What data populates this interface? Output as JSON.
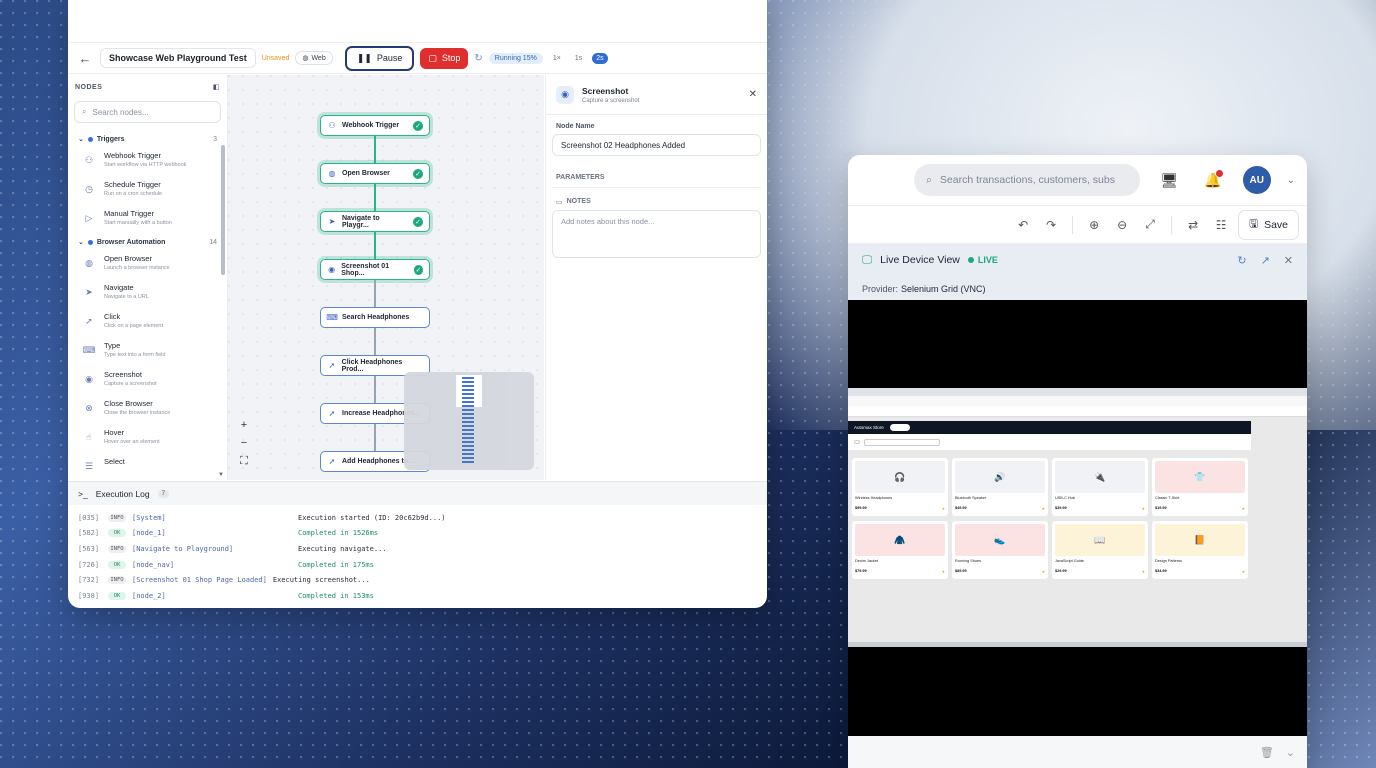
{
  "editor": {
    "workflow_name": "Showcase Web Playground Test",
    "unsaved": "Unsaved",
    "platform": "Web",
    "pause_label": "Pause",
    "stop_label": "Stop",
    "running_label": "Running 15%",
    "running_progress": 0.15,
    "speeds": [
      "1×",
      "1s",
      "2s"
    ],
    "active_speed": "2s"
  },
  "sidebar": {
    "title": "NODES",
    "search_placeholder": "Search nodes...",
    "categories": [
      {
        "name": "Triggers",
        "count": "3",
        "items": [
          {
            "title": "Webhook Trigger",
            "desc": "Start workflow via HTTP webhook",
            "icon": "webhook-icon"
          },
          {
            "title": "Schedule Trigger",
            "desc": "Run on a cron schedule",
            "icon": "clock-icon"
          },
          {
            "title": "Manual Trigger",
            "desc": "Start manually with a button",
            "icon": "play-icon"
          }
        ]
      },
      {
        "name": "Browser Automation",
        "count": "14",
        "items": [
          {
            "title": "Open Browser",
            "desc": "Launch a browser instance",
            "icon": "globe-icon"
          },
          {
            "title": "Navigate",
            "desc": "Navigate to a URL",
            "icon": "send-icon"
          },
          {
            "title": "Click",
            "desc": "Click on a page element",
            "icon": "cursor-icon"
          },
          {
            "title": "Type",
            "desc": "Type text into a form field",
            "icon": "keyboard-icon"
          },
          {
            "title": "Screenshot",
            "desc": "Capture a screenshot",
            "icon": "camera-icon"
          },
          {
            "title": "Close Browser",
            "desc": "Close the browser instance",
            "icon": "close-circle-icon"
          },
          {
            "title": "Hover",
            "desc": "Hover over an element",
            "icon": "pointer-icon"
          },
          {
            "title": "Select",
            "desc": "",
            "icon": "list-icon"
          }
        ]
      }
    ]
  },
  "flow": {
    "nodes": [
      {
        "label": "Webhook Trigger",
        "status": "done",
        "icon": "webhook-icon"
      },
      {
        "label": "Open Browser",
        "status": "done",
        "icon": "globe-icon"
      },
      {
        "label": "Navigate to Playgr...",
        "status": "done",
        "icon": "send-icon"
      },
      {
        "label": "Screenshot 01 Shop...",
        "status": "done",
        "icon": "camera-icon"
      },
      {
        "label": "Search Headphones",
        "status": "pending",
        "icon": "keyboard-icon"
      },
      {
        "label": "Click Headphones Prod...",
        "status": "pending",
        "icon": "cursor-icon"
      },
      {
        "label": "Increase Headphones...",
        "status": "pending",
        "icon": "cursor-icon"
      },
      {
        "label": "Add Headphones to...",
        "status": "pending",
        "icon": "cursor-icon"
      }
    ]
  },
  "props": {
    "title": "Screenshot",
    "subtitle": "Capture a screenshot",
    "node_name_label": "Node Name",
    "node_name_value": "Screenshot 02 Headphones Added",
    "parameters_label": "PARAMETERS",
    "notes_label": "NOTES",
    "notes_placeholder": "Add notes about this node..."
  },
  "log": {
    "title": "Execution Log",
    "count": "7",
    "lines": [
      {
        "ts": "[035]",
        "level": "INFO",
        "src": "[System]",
        "msg": "Execution started (ID: 20c62b9d...)"
      },
      {
        "ts": "[582]",
        "level": "OK",
        "src": "[node_1]",
        "msg": "Completed in 1526ms"
      },
      {
        "ts": "[563]",
        "level": "INFO",
        "src": "[Navigate to Playground]",
        "msg": "Executing navigate..."
      },
      {
        "ts": "[726]",
        "level": "OK",
        "src": "[node_nav]",
        "msg": "Completed in 175ms"
      },
      {
        "ts": "[732]",
        "level": "INFO",
        "src": "[Screenshot 01 Shop Page Loaded]",
        "msg": "Executing screenshot..."
      },
      {
        "ts": "[938]",
        "level": "OK",
        "src": "[node_2]",
        "msg": "Completed in 153ms"
      }
    ]
  },
  "panel": {
    "search_placeholder": "Search transactions, customers, subs",
    "avatar_initials": "AU",
    "save_label": "Save",
    "device_view_title": "Live Device View",
    "live_label": "LIVE",
    "provider_label": "Provider:",
    "provider_value": "Selenium Grid (VNC)"
  },
  "shop": {
    "brand": "Automax Store",
    "products": [
      {
        "name": "Wireless Headphones",
        "price": "$99.99",
        "icon": "🎧",
        "bg": "#f1f2f5"
      },
      {
        "name": "Bluetooth Speaker",
        "price": "$49.99",
        "icon": "🔊",
        "bg": "#f1f2f5"
      },
      {
        "name": "USB-C Hub",
        "price": "$39.99",
        "icon": "🔌",
        "bg": "#f1f2f5"
      },
      {
        "name": "Classic T-Shirt",
        "price": "$19.99",
        "icon": "👕",
        "bg": "#fbe3e3"
      },
      {
        "name": "Denim Jacket",
        "price": "$79.99",
        "icon": "🧥",
        "bg": "#fbe3e3"
      },
      {
        "name": "Running Shoes",
        "price": "$89.99",
        "icon": "👟",
        "bg": "#fbe3e3"
      },
      {
        "name": "JavaScript Guide",
        "price": "$29.99",
        "icon": "📖",
        "bg": "#fcf3d8"
      },
      {
        "name": "Design Patterns",
        "price": "$34.99",
        "icon": "📙",
        "bg": "#fcf3d8"
      }
    ]
  }
}
